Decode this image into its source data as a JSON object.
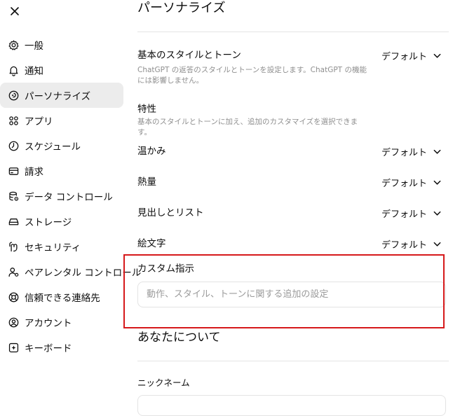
{
  "close": {
    "icon": "close-icon"
  },
  "sidebar": {
    "items": [
      {
        "label": "一般",
        "icon": "gear-icon"
      },
      {
        "label": "通知",
        "icon": "bell-icon"
      },
      {
        "label": "パーソナライズ",
        "icon": "personalize-icon",
        "active": true
      },
      {
        "label": "アプリ",
        "icon": "apps-grid-icon"
      },
      {
        "label": "スケジュール",
        "icon": "clock-icon"
      },
      {
        "label": "請求",
        "icon": "credit-card-icon"
      },
      {
        "label": "データ コントロール",
        "icon": "database-gear-icon"
      },
      {
        "label": "ストレージ",
        "icon": "storage-drive-icon"
      },
      {
        "label": "セキュリティ",
        "icon": "security-icon"
      },
      {
        "label": "ペアレンタル コントロール",
        "icon": "parental-user-icon"
      },
      {
        "label": "信頼できる連絡先",
        "icon": "lifebuoy-icon"
      },
      {
        "label": "アカウント",
        "icon": "account-icon"
      },
      {
        "label": "キーボード",
        "icon": "keyboard-icon"
      }
    ]
  },
  "main": {
    "title": "パーソナライズ",
    "base_style": {
      "label": "基本のスタイルとトーン",
      "description": "ChatGPT の返答のスタイルとトーンを設定します。ChatGPT の機能には影響しません。",
      "value": "デフォルト"
    },
    "traits": {
      "label": "特性",
      "description": "基本のスタイルとトーンに加え、追加のカスタマイズを選択できます。"
    },
    "settings": [
      {
        "label": "温かみ",
        "value": "デフォルト"
      },
      {
        "label": "熱量",
        "value": "デフォルト"
      },
      {
        "label": "見出しとリスト",
        "value": "デフォルト"
      },
      {
        "label": "絵文字",
        "value": "デフォルト"
      }
    ],
    "custom_instructions": {
      "label": "カスタム指示",
      "placeholder": "動作、スタイル、トーンに関する追加の設定",
      "value": ""
    },
    "about_you": {
      "title": "あなたについて",
      "nickname_label": "ニックネーム"
    }
  },
  "colors": {
    "highlight_border": "#d6191b",
    "active_nav_bg": "#ececec",
    "muted_text": "#8f8f8f"
  }
}
